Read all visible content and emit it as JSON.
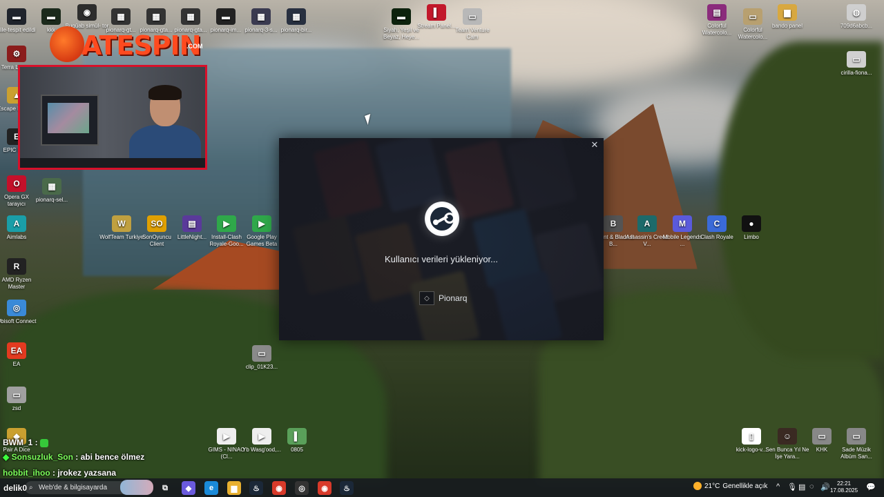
{
  "desktop_icons": [
    {
      "label": "dile-tespit edildi",
      "color": "#20242c",
      "glyph": "▬"
    },
    {
      "label": "kkk",
      "color": "#1c2a1c",
      "glyph": "▬"
    },
    {
      "label": "Bugüab simül- tor",
      "color": "#2d2d2d",
      "glyph": "◉"
    },
    {
      "label": "pionarq-gt...",
      "color": "#333",
      "glyph": "▦"
    },
    {
      "label": "pionarq-gta...",
      "color": "#333",
      "glyph": "▦"
    },
    {
      "label": "pionarq-gta...",
      "color": "#333",
      "glyph": "▦"
    },
    {
      "label": "pionarq-im...",
      "color": "#222",
      "glyph": "▬"
    },
    {
      "label": "pionarq-3-s...",
      "color": "#3a3a50",
      "glyph": "▦"
    },
    {
      "label": "pionarq-bir...",
      "color": "#283040",
      "glyph": "▦"
    },
    {
      "label": "Siyah, Yeşil ve Beyaz, Heye...",
      "color": "#0d220d",
      "glyph": "▬"
    },
    {
      "label": "Stream Panel...",
      "color": "#c2182b",
      "glyph": "▌"
    },
    {
      "label": "Team Venture Cam",
      "color": "#b8b8b8",
      "glyph": "▭"
    },
    {
      "label": "Colorful Watercolo...",
      "color": "#8b2c7c",
      "glyph": "▤"
    },
    {
      "label": "Colorful Watercolo...",
      "color": "#b8a070",
      "glyph": "▭"
    },
    {
      "label": "bando panel",
      "color": "#d8a840",
      "glyph": "▆"
    },
    {
      "label": "709d6abcb...",
      "color": "#cfcfcf",
      "glyph": "◍"
    },
    {
      "label": "cirilla-fiona...",
      "color": "#d0d0d0",
      "glyph": "▭"
    },
    {
      "label": "Terra Legion",
      "color": "#8b1c1c",
      "glyph": "⚙"
    },
    {
      "label": "Escape Backr...",
      "color": "#caa030",
      "glyph": "▲"
    },
    {
      "label": "EPIC Ma...",
      "color": "#222",
      "glyph": "E"
    },
    {
      "label": "Opera GX tarayıcı",
      "color": "#c4102a",
      "glyph": "O"
    },
    {
      "label": "pionarq-sel...",
      "color": "#4a6a4a",
      "glyph": "▦"
    },
    {
      "label": "Aimlabs",
      "color": "#1a9ea8",
      "glyph": "A"
    },
    {
      "label": "AMD Ryzen Master",
      "color": "#222",
      "glyph": "R"
    },
    {
      "label": "Ubisoft Connect",
      "color": "#3a8ad8",
      "glyph": "◎"
    },
    {
      "label": "EA",
      "color": "#e33a20",
      "glyph": "EA"
    },
    {
      "label": "zsd",
      "color": "#a0a0a0",
      "glyph": "▭"
    },
    {
      "label": "Pair A Dice",
      "color": "#caa030",
      "glyph": "◆"
    },
    {
      "label": "WolfTeam Turkiye",
      "color": "#c0a040",
      "glyph": "W"
    },
    {
      "label": "SonOyuncu Client",
      "color": "#e0a000",
      "glyph": "SO"
    },
    {
      "label": "LittleNight...",
      "color": "#5a3a9a",
      "glyph": "▤"
    },
    {
      "label": "Install-Clash Royale-Goo...",
      "color": "#2fa84a",
      "glyph": "▶"
    },
    {
      "label": "Google Play Games Beta",
      "color": "#2fa84a",
      "glyph": "▶"
    },
    {
      "label": "clip_01K23...",
      "color": "#8a8a8a",
      "glyph": "▭"
    },
    {
      "label": "Mount & Blade II B...",
      "color": "#555",
      "glyph": "B"
    },
    {
      "label": "Assassin's Creed V...",
      "color": "#1c6a6a",
      "glyph": "A"
    },
    {
      "label": "Mobile Legends ...",
      "color": "#5a5adc",
      "glyph": "M"
    },
    {
      "label": "Clash Royale",
      "color": "#3a6ad8",
      "glyph": "C"
    },
    {
      "label": "Limbo",
      "color": "#111",
      "glyph": "●"
    },
    {
      "label": "GIMS - NINAO (Cl...",
      "color": "#eee",
      "glyph": "▶"
    },
    {
      "label": "Yb Wasg'ood,...",
      "color": "#eee",
      "glyph": "▶"
    },
    {
      "label": "0805",
      "color": "#5aa05a",
      "glyph": "▌"
    },
    {
      "label": "kick-logo-v...",
      "color": "#fff",
      "glyph": "▯"
    },
    {
      "label": "Sen Bunca Yıl Ne İşe Yara...",
      "color": "#3a2a22",
      "glyph": "☺"
    },
    {
      "label": "KHK",
      "color": "#888",
      "glyph": "▭"
    },
    {
      "label": "Sade Müzik Albüm San...",
      "color": "#888",
      "glyph": "▭"
    }
  ],
  "logo": {
    "word": "ATESPIN",
    "tld": ".COM"
  },
  "dialog": {
    "close_glyph": "✕",
    "status": "Kullanıcı verileri yükleniyor...",
    "username": "Pionarq",
    "avatar_glyph": "◇"
  },
  "chat": [
    {
      "user": "BWM_1",
      "sep": " :",
      "msg": ""
    },
    {
      "user": "Sonsuzluk_Son",
      "sep": " :",
      "msg": "abi bence ölmez"
    },
    {
      "user": "hobbit_ihoo",
      "sep": " :",
      "msg": "jrokez yazsana"
    },
    {
      "user": "delik0",
      "sep": "",
      "msg": ""
    }
  ],
  "taskbar": {
    "search_placeholder": "Web'de & bilgisayarda",
    "weather_temp": "21°C",
    "weather_text": "Genellikle açık",
    "time": "22:21",
    "date": "17.08.2025",
    "apps": [
      {
        "name": "task-view",
        "glyph": "⧉",
        "color": "transparent"
      },
      {
        "name": "copilot",
        "glyph": "◆",
        "color": "#6a5adc"
      },
      {
        "name": "edge",
        "glyph": "e",
        "color": "#1a8ad8"
      },
      {
        "name": "file-explorer",
        "glyph": "▆",
        "color": "#e8b030"
      },
      {
        "name": "steam",
        "glyph": "♨",
        "color": "#1b2838"
      },
      {
        "name": "chrome",
        "glyph": "◉",
        "color": "#d83a2a"
      },
      {
        "name": "obs",
        "glyph": "◎",
        "color": "#333"
      },
      {
        "name": "chrome-2",
        "glyph": "◉",
        "color": "#d83a2a"
      },
      {
        "name": "steam-2",
        "glyph": "♨",
        "color": "#1b2838"
      }
    ]
  }
}
